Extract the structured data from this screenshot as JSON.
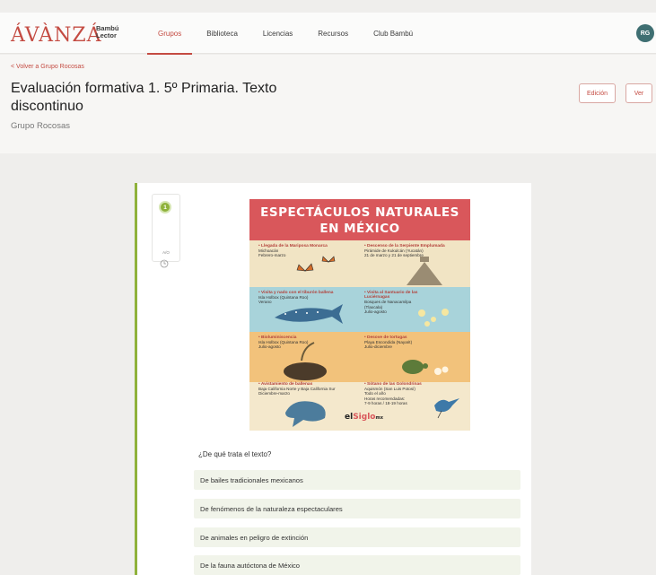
{
  "header": {
    "brand": "ÁVÀNZÁ",
    "sub_brand_line1": "Bambú",
    "sub_brand_line2": "Lector",
    "nav": [
      "Grupos",
      "Biblioteca",
      "Licencias",
      "Recursos",
      "Club Bambú"
    ],
    "active_nav": "Grupos",
    "avatar_initials": "RG"
  },
  "page": {
    "back_link": "< Volver a Grupo Rocosas",
    "title": "Evaluación formativa 1. 5º Primaria. Texto discontinuo",
    "subtitle": "Grupo Rocosas",
    "edit_button": "Edición",
    "view_button": "Ver"
  },
  "question_panel": {
    "number": "1",
    "type_label": "A/O",
    "accent_color": "#8fb23b"
  },
  "infographic": {
    "title_line1": "ESPECTÁCULOS NATURALES",
    "title_line2": "EN MÉXICO",
    "items": [
      {
        "heading": "• Llegada de la Mariposa Monarca",
        "detail": "Michoacán\nFebrero-marzo"
      },
      {
        "heading": "• Descenso de la Serpiente Emplumada",
        "detail": "Pirámide de Kukulcán (Yucatán)\n21 de marzo y 21 de septiembre"
      },
      {
        "heading": "• Visita y nado con el tiburón ballena",
        "detail": "Isla Holbox (Quintana Roo)\nVerano"
      },
      {
        "heading": "• Visita al Santuario de las Luciérnagas",
        "detail": "Bosques de Nanacamilpa (Tlaxcala)\nJulio-agosto"
      },
      {
        "heading": "• Bioluminiscencia",
        "detail": "Isla Holbox (Quintana Roo)\nJulio-agosto"
      },
      {
        "heading": "• Desove de tortugas",
        "detail": "Playa Escondida (Nayarit)\nJulio-diciembre"
      },
      {
        "heading": "• Avistamiento de ballenas",
        "detail": "Baja California Norte y Baja California Sur\nDiciembre-marzo"
      },
      {
        "heading": "• Sótano de las Golondrinas",
        "detail": "Aquismón (San Luis Potosí)\nTodo el año\nHoras recomendadas:\n7-9 horas / 18-19 horas"
      }
    ],
    "logo_part1": "el",
    "logo_part2": "Siglo",
    "logo_part3": "mx"
  },
  "question": {
    "text": "¿De qué trata el texto?",
    "options": [
      "De bailes tradicionales mexicanos",
      "De fenómenos de la naturaleza espectaculares",
      "De animales en peligro de extinción",
      "De la fauna autóctona de México"
    ]
  }
}
